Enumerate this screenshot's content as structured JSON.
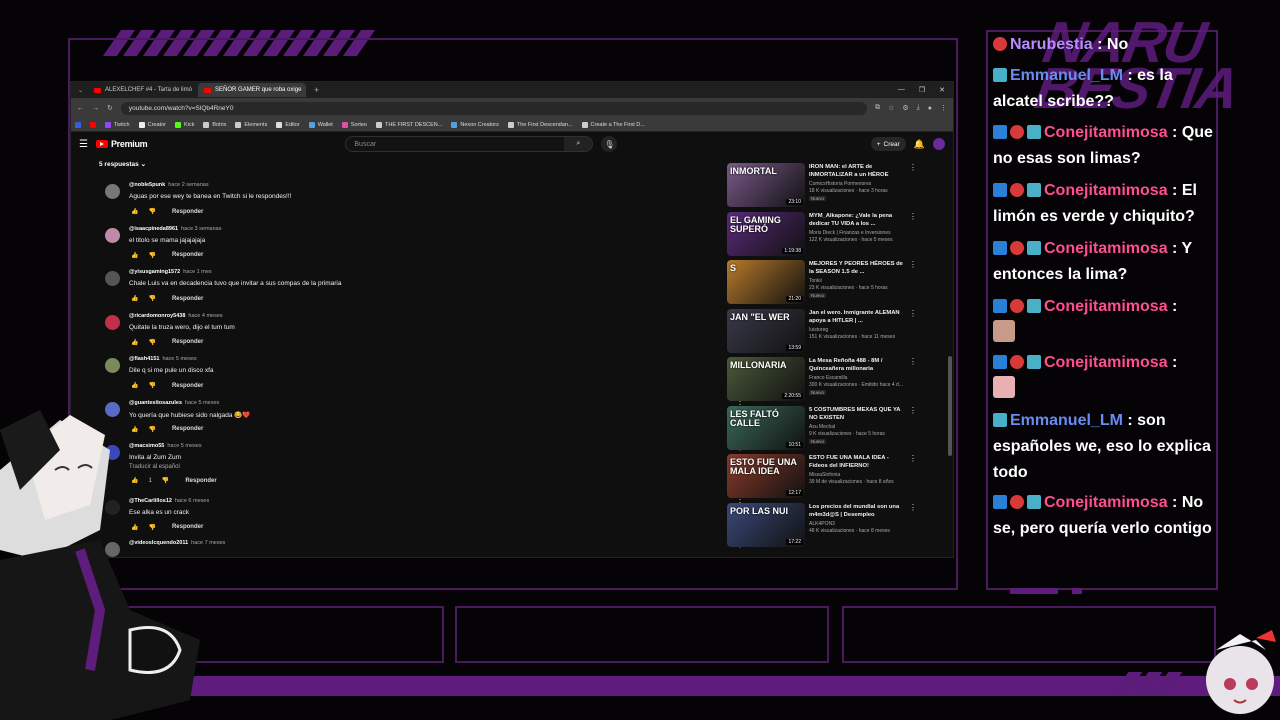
{
  "browser": {
    "tabs": [
      {
        "label": "ALEXELCHEF #4 - Tarta de limó",
        "active": false
      },
      {
        "label": "SEÑOR GAMER que roba oxige",
        "active": true
      }
    ],
    "url": "youtube.com/watch?v=SlQb4RneY0",
    "bookmarks": [
      "Twitch",
      "Creator",
      "Kick",
      "Botrix",
      "Elements",
      "Editor",
      "Wallet",
      "Sorteo",
      "THE FIRST DESCEN...",
      "Nexon Creators",
      "The First Descendan...",
      "Create a The First D..."
    ]
  },
  "youtube": {
    "logo": "Premium",
    "search_placeholder": "Buscar",
    "create_label": "Crear",
    "replies_count_label": "5 respuestas",
    "comments": [
      {
        "user": "@noble5punk",
        "time": "hace 2 semanas",
        "text": "Aguas por ese wey te banea en Twitch si le respondes!!!",
        "reply": "Responder",
        "color": "#777"
      },
      {
        "user": "@isaacpineda8961",
        "time": "hace 3 semanas",
        "text": "el titolo se mama jajajajaja",
        "reply": "Responder",
        "color": "#c08aa8"
      },
      {
        "user": "@yisusgaming1572",
        "time": "hace 1 mes",
        "text": "Chale Luis va en decadencia tuvo que invitar a sus compas de la primaria",
        "reply": "Responder",
        "color": "#555"
      },
      {
        "user": "@ricardomonroy5438",
        "time": "hace 4 meses",
        "text": "Quitate la truza wero, dijo el tum tum",
        "reply": "Responder",
        "color": "#c0304a"
      },
      {
        "user": "@flash4151",
        "time": "hace 5 meses",
        "text": "Dile q si me pule un disco xfa",
        "reply": "Responder",
        "color": "#7a8a5a"
      },
      {
        "user": "@guantesitosazules",
        "time": "hace 5 meses",
        "text": "Yo quería que hubiese sido nalgada 😂❤️",
        "reply": "Responder",
        "color": "#5a6ac8"
      },
      {
        "user": "@macsimo55",
        "time": "hace 5 meses",
        "text": "Invita al Zum Zum",
        "reply": "Responder",
        "translate": "Traducir al español",
        "likes": "1",
        "color": "#3a48b8"
      },
      {
        "user": "@TheCarlillos12",
        "time": "hace 6 meses",
        "text": "Ese alka es un crack",
        "reply": "Responder",
        "color": "#222"
      },
      {
        "user": "@videoslcquendo2011",
        "time": "hace 7 meses",
        "text": "",
        "reply": "",
        "color": "#666"
      }
    ],
    "recommendations": [
      {
        "title": "IRON MAN: el ARTE de INMORTALIZAR a un HÉROE",
        "channel": "ComicsHistoria Pormenores",
        "views": "18 K visualizaciones · hace 3 horas",
        "badge": "Nuevo",
        "duration": "23:10",
        "thumb_text": "INMORTAL",
        "color": "#7a5a8a"
      },
      {
        "title": "MYM_Alkapone: ¿Vale la pena dedicar TU VIDA a los ...",
        "channel": "Moris Dieck | Finanzas e Inversiones",
        "views": "122 K visualizaciones · hace 5 meses",
        "badge": "",
        "duration": "1:19:38",
        "thumb_text": "EL GAMING SUPERÓ",
        "color": "#5a2a7a"
      },
      {
        "title": "MEJORES Y PEORES HÉROES de la SEASON 1.5 de ...",
        "channel": "Tonkii",
        "views": "23 K visualizaciones · hace 5 horas",
        "badge": "Nuevo",
        "duration": "21:20",
        "thumb_text": "S",
        "color": "#b87a2a"
      },
      {
        "title": "Jan el wero. Inmigrante ALEMAN apoya a HITLER | ...",
        "channel": "Iuistoreg",
        "views": "151 K visualizaciones · hace 11 meses",
        "badge": "",
        "duration": "13:59",
        "thumb_text": "JAN \"EL WER",
        "color": "#3a3a4a"
      },
      {
        "title": "La Mesa Reñoña 488 - 8M / Quinceañera millonaria",
        "channel": "Franco Escamilla",
        "views": "300 K visualizaciones · Emitido hace 4 d...",
        "badge": "Nuevo",
        "duration": "2:20:55",
        "thumb_text": "MILLONARIA",
        "color": "#4a5a3a"
      },
      {
        "title": "5 COSTUMBRES MEXAS QUE YA NO EXISTEN",
        "channel": "Asu Mechal",
        "views": "9 K visualizaciones · hace 5 horas",
        "badge": "Nuevo",
        "duration": "10:51",
        "thumb_text": "LES FALTÓ CALLE",
        "color": "#3a6a5a"
      },
      {
        "title": "ESTO FUE UNA MALA IDEA - Fideos del INFIERNO!",
        "channel": "MissaSinfonia",
        "views": "39 M de visualizaciones · hace 8 años",
        "badge": "",
        "duration": "12:17",
        "thumb_text": "ESTO FUE UNA MALA IDEA",
        "color": "#8a3a2a"
      },
      {
        "title": "Los precios del mundial son una m4m3d@S | Desempleo",
        "channel": "ALK4PON3",
        "views": "48 K visualizaciones · hace 8 meses",
        "badge": "",
        "duration": "17:22",
        "thumb_text": "POR LAS NUI",
        "color": "#3a4a7a"
      }
    ]
  },
  "chat": {
    "brand": "NARU BESTIA",
    "messages": [
      {
        "user": "Narubestia",
        "text": "No",
        "color": "purple"
      },
      {
        "user": "Emmanuel_LM",
        "text": "es la alcatel scribe??",
        "color": "blue"
      },
      {
        "user": "Conejitamimosa",
        "text": "Que no esas son limas?",
        "color": "pink"
      },
      {
        "user": "Conejitamimosa",
        "text": "El limón es verde y chiquito?",
        "color": "pink"
      },
      {
        "user": "Conejitamimosa",
        "text": "Y entonces la lima?",
        "color": "pink"
      },
      {
        "user": "Conejitamimosa",
        "text": "",
        "color": "pink"
      },
      {
        "user": "Conejitamimosa",
        "text": "",
        "color": "pink"
      },
      {
        "user": "Emmanuel_LM",
        "text": "son españoles we, eso lo explica todo",
        "color": "blue"
      },
      {
        "user": "Conejitamimosa",
        "text": "No se, pero quería verlo contigo",
        "color": "pink"
      }
    ]
  }
}
